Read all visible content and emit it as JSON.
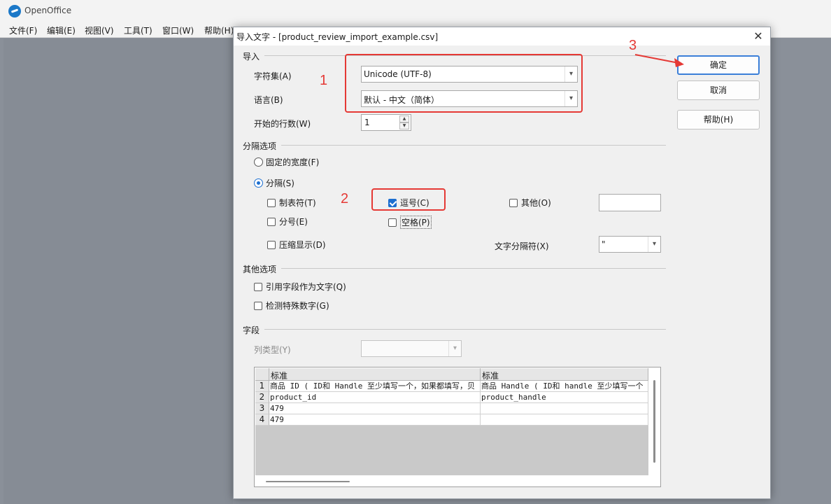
{
  "app": {
    "title": "OpenOffice",
    "menu": [
      "文件(F)",
      "编辑(E)",
      "视图(V)",
      "工具(T)",
      "窗口(W)",
      "帮助(H)"
    ]
  },
  "dialog": {
    "title": "导入文字 - [product_review_import_example.csv]",
    "close": "✕",
    "import_section": {
      "label": "导入",
      "charset_label": "字符集(A)",
      "charset_value": "Unicode (UTF-8)",
      "language_label": "语言(B)",
      "language_value": "默认 - 中文（简体）",
      "start_row_label": "开始的行数(W)",
      "start_row_value": "1"
    },
    "separator_section": {
      "label": "分隔选项",
      "fixed_width": "固定的宽度(F)",
      "separated": "分隔(S)",
      "tab": "制表符(T)",
      "comma": "逗号(C)",
      "other": "其他(O)",
      "semicolon": "分号(E)",
      "space": "空格(P)",
      "merge": "压缩显示(D)",
      "text_delimiter_label": "文字分隔符(X)",
      "text_delimiter_value": "\""
    },
    "other_section": {
      "label": "其他选项",
      "quoted_as_text": "引用字段作为文字(Q)",
      "detect_numbers": "检测特殊数字(G)"
    },
    "fields_section": {
      "label": "字段",
      "column_type_label": "列类型(Y)",
      "column_type_value": ""
    },
    "buttons": {
      "ok": "确定",
      "cancel": "取消",
      "help": "帮助(H)"
    },
    "preview": {
      "column_headers": [
        "标准",
        "标准"
      ],
      "rows": [
        {
          "num": "1",
          "cells": [
            "商品 ID ( ID和 Handle 至少填写一个，如果都填写，贝",
            "商品 Handle ( ID和 handle 至少填写一个"
          ]
        },
        {
          "num": "2",
          "cells": [
            "product_id",
            "product_handle"
          ]
        },
        {
          "num": "3",
          "cells": [
            "479",
            ""
          ]
        },
        {
          "num": "4",
          "cells": [
            "479",
            ""
          ]
        }
      ]
    }
  },
  "annotations": [
    "1",
    "2",
    "3"
  ],
  "colors": {
    "annotation": "#e53935",
    "accent": "#1d6fd0"
  }
}
